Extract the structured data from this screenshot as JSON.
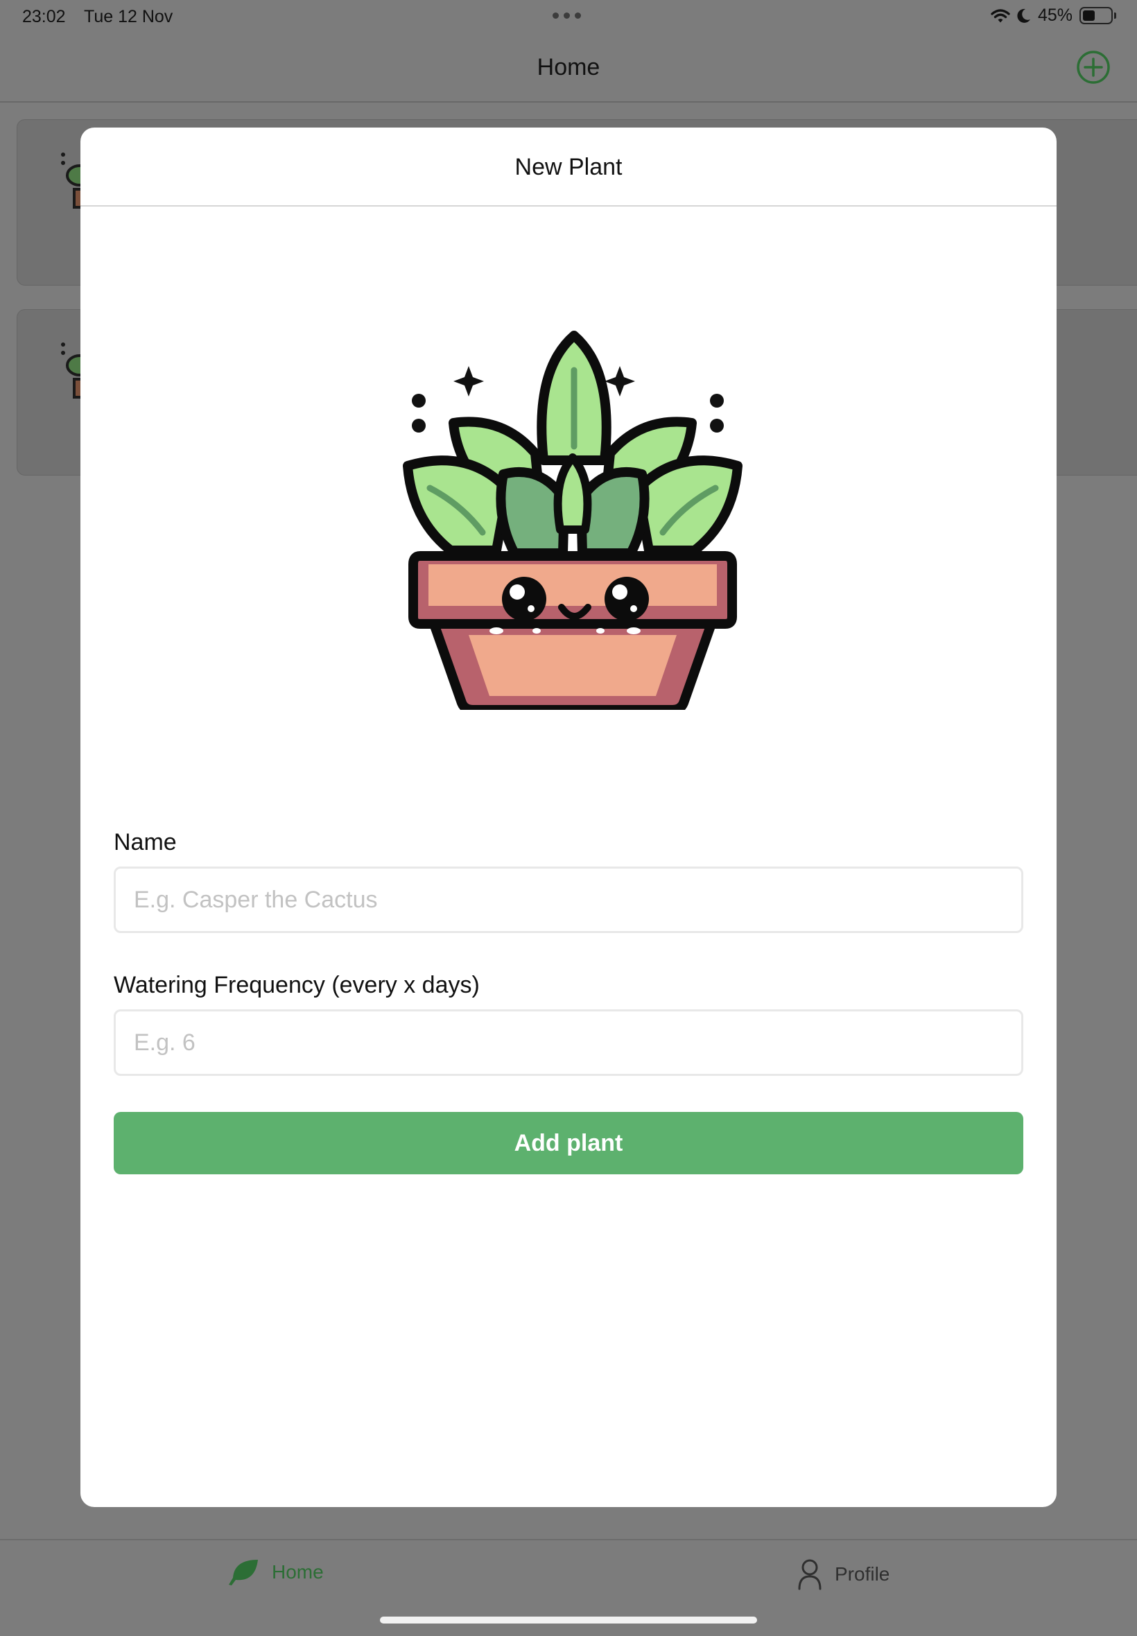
{
  "status_bar": {
    "time": "23:02",
    "date": "Tue 12 Nov",
    "battery_percent": "45%",
    "battery_level": 0.45
  },
  "nav": {
    "title": "Home",
    "add_icon": "plus-circle-icon"
  },
  "modal": {
    "title": "New Plant",
    "illustration": "potted-plant-illustration",
    "name_label": "Name",
    "name_placeholder": "E.g. Casper the Cactus",
    "name_value": "",
    "frequency_label": "Watering Frequency (every x days)",
    "frequency_placeholder": "E.g. 6",
    "frequency_value": "",
    "add_button_label": "Add plant"
  },
  "tab_bar": {
    "tabs": [
      {
        "label": "Home",
        "icon": "leaf-icon",
        "selected": true
      },
      {
        "label": "Profile",
        "icon": "person-icon",
        "selected": false
      }
    ]
  },
  "colors": {
    "accent": "#5db16e",
    "tab_selected": "#2c6e35",
    "overlay": "#7c7c7c"
  }
}
